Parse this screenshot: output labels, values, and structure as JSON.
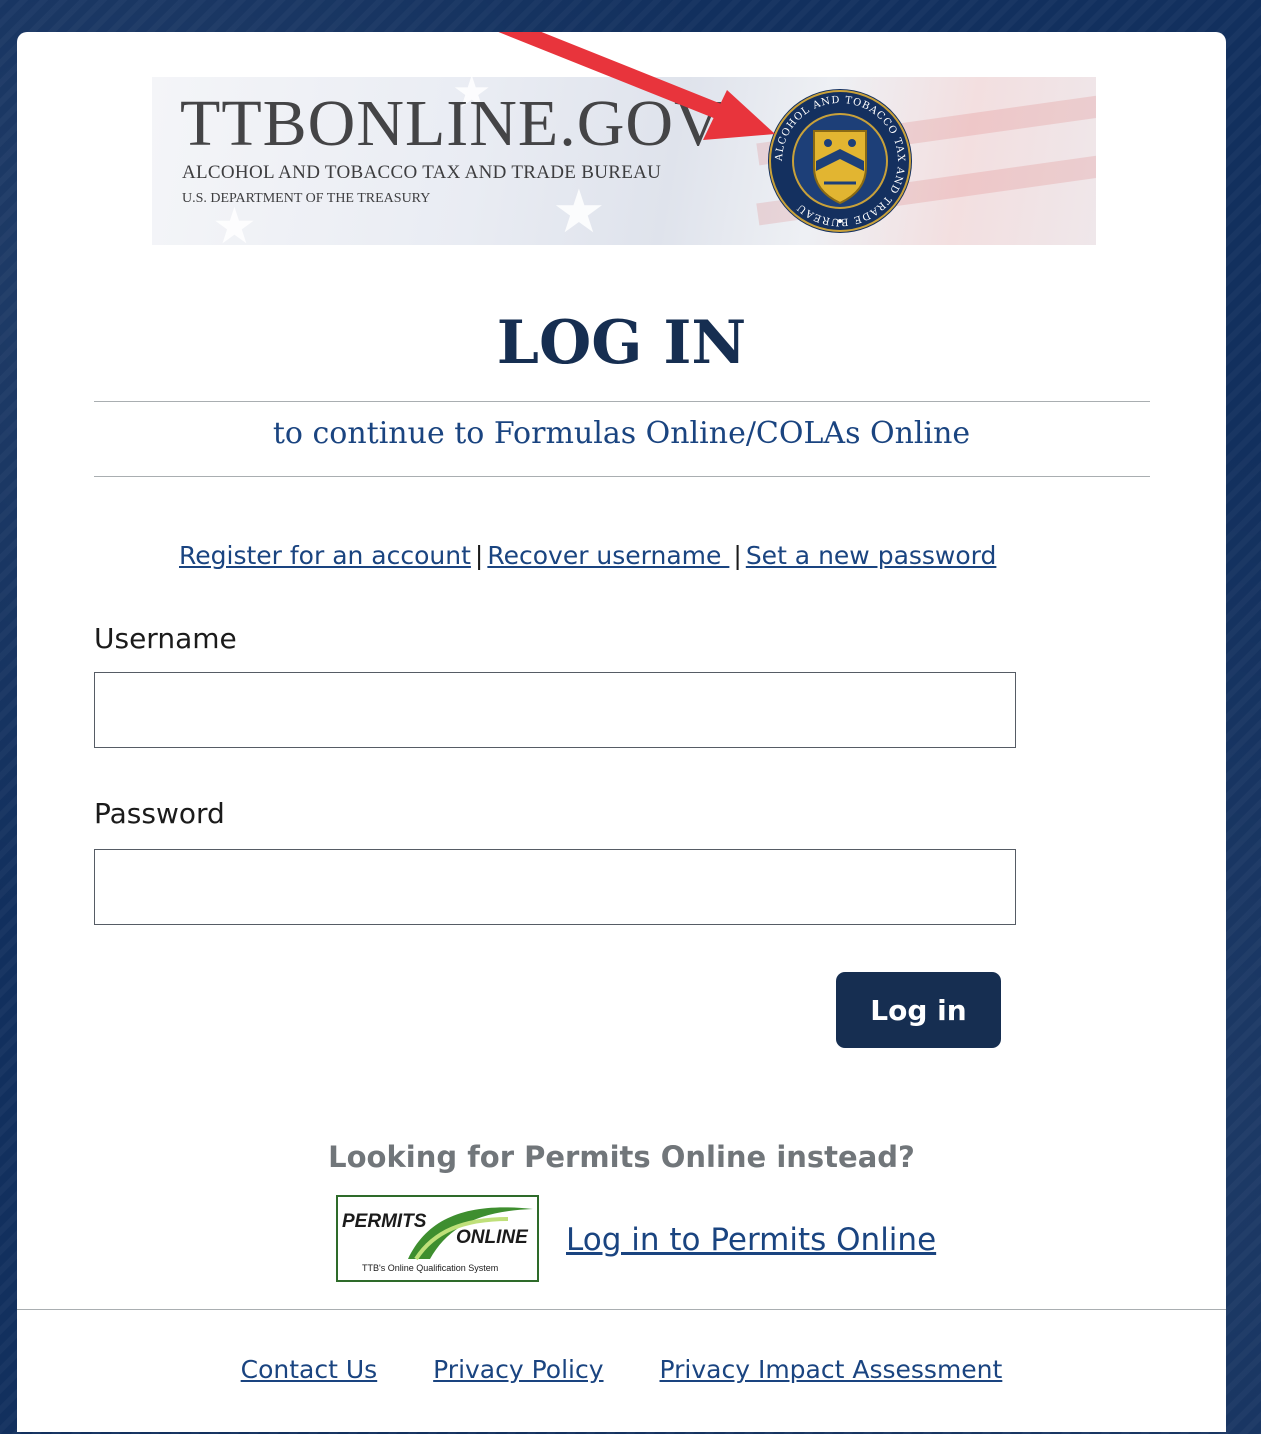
{
  "banner": {
    "brand_main": "TTBONLINE.GOV",
    "brand_sub": "ALCOHOL AND TOBACCO TAX AND TRADE BUREAU",
    "brand_sub2": "U.S. DEPARTMENT OF THE TREASURY",
    "seal_text": "ALCOHOL AND TOBACCO TAX AND TRADE BUREAU"
  },
  "page": {
    "title": "LOG IN",
    "subtitle": "to continue to Formulas Online/COLAs Online"
  },
  "account_links": {
    "register": "Register for an account",
    "separator": "|",
    "recover": "Recover username ",
    "set_password": "Set a new password"
  },
  "form": {
    "username_label": "Username",
    "username_value": "",
    "password_label": "Password",
    "password_value": "",
    "submit_label": "Log in"
  },
  "permits": {
    "question": "Looking for Permits Online instead?",
    "logo_word1": "PERMITS",
    "logo_word2": "ONLINE",
    "logo_tagline": "TTB's Online Qualification System",
    "link": "Log in to Permits Online"
  },
  "footer": {
    "contact": "Contact Us",
    "privacy": "Privacy Policy",
    "impact": "Privacy Impact Assessment"
  },
  "colors": {
    "primary": "#162e51",
    "link": "#1a4480",
    "annotation_arrow": "#e8343c"
  }
}
